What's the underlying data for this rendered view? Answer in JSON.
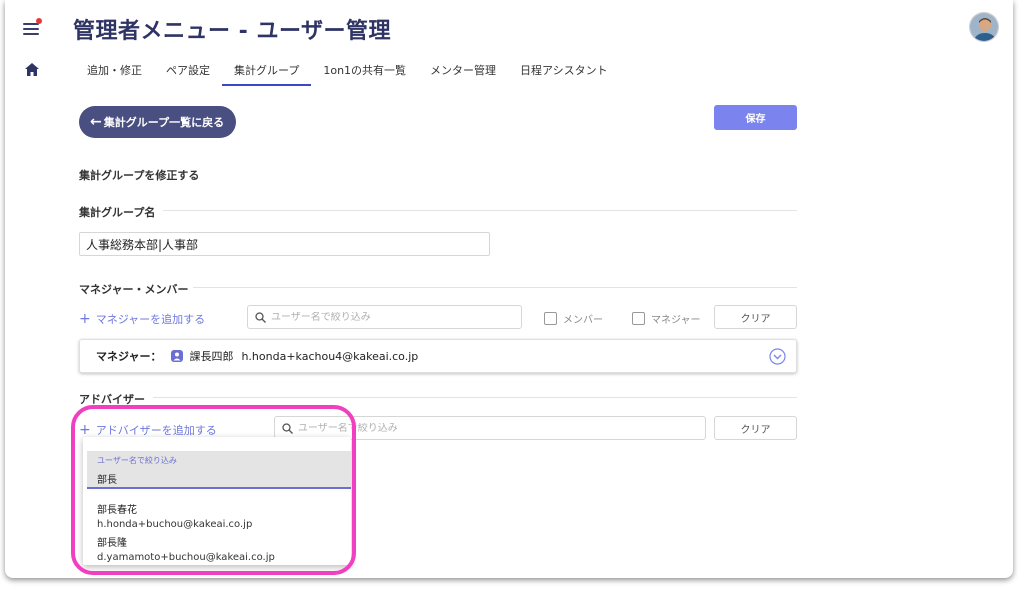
{
  "header": {
    "title": "管理者メニュー - ユーザー管理"
  },
  "tabs": [
    {
      "label": "追加・修正",
      "active": false
    },
    {
      "label": "ペア設定",
      "active": false
    },
    {
      "label": "集計グループ",
      "active": true
    },
    {
      "label": "1on1の共有一覧",
      "active": false
    },
    {
      "label": "メンター管理",
      "active": false
    },
    {
      "label": "日程アシスタント",
      "active": false
    }
  ],
  "toolbar": {
    "back_label": "集計グループ一覧に戻る",
    "save_label": "保存"
  },
  "form": {
    "heading": "集計グループを修正する",
    "group_name_label": "集計グループ名",
    "group_name_value": "人事総務本部|人事部"
  },
  "managers": {
    "heading": "マネジャー・メンバー",
    "add_label": "マネジャーを追加する",
    "search_placeholder": "ユーザー名で絞り込み",
    "filter_member": "メンバー",
    "filter_manager": "マネジャー",
    "clear_label": "クリア",
    "card": {
      "role_label": "マネジャー：",
      "name": "課長四郎",
      "email": "h.honda+kachou4@kakeai.co.jp"
    }
  },
  "advisors": {
    "heading": "アドバイザー",
    "add_label": "アドバイザーを追加する",
    "search_placeholder": "ユーザー名で絞り込み",
    "clear_label": "クリア"
  },
  "dropdown": {
    "field_label": "ユーザー名で絞り込み",
    "field_value": "部長",
    "results": [
      {
        "name": "部長春花",
        "email": "h.honda+buchou@kakeai.co.jp"
      },
      {
        "name": "部長隆",
        "email": "d.yamamoto+buchou@kakeai.co.jp"
      }
    ]
  },
  "colors": {
    "accent": "#7b84ee",
    "primary_dark": "#4a4f82",
    "title": "#2f3464",
    "highlight": "#f03fbf"
  }
}
